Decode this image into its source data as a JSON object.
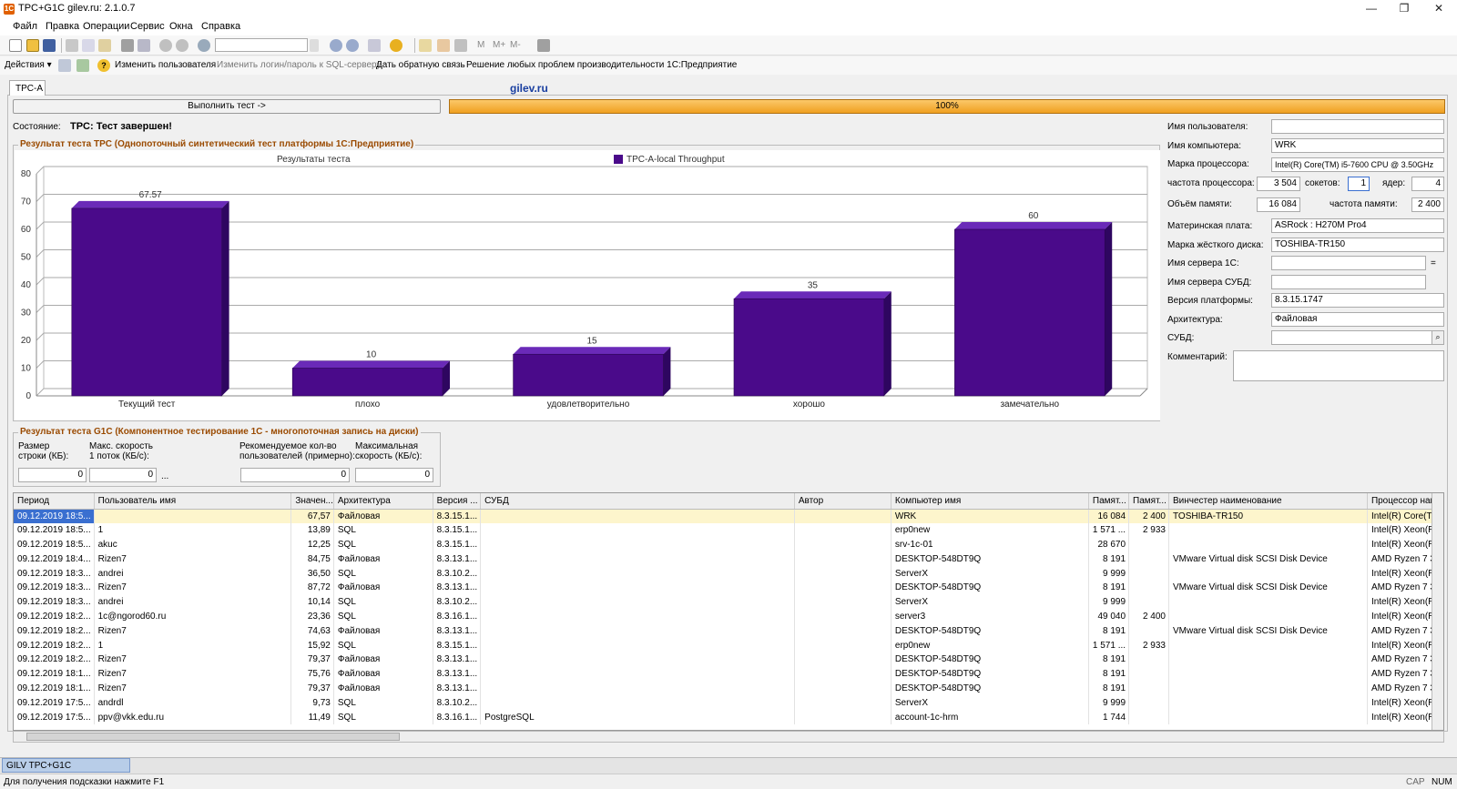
{
  "window": {
    "title": "TPC+G1C gilev.ru: 2.1.0.7",
    "app_icon": "1С"
  },
  "menu": [
    "Файл",
    "Правка",
    "Операции",
    "Сервис",
    "Окна",
    "Справка"
  ],
  "actionbar": {
    "actions_label": "Действия ▾",
    "change_user": "Изменить пользователя",
    "change_login": "Изменить логин/пароль к SQL-серверу",
    "feedback": "Дать обратную связь",
    "solve_problems": "Решение любых проблем производительности 1С:Предприятие"
  },
  "toolbar_text": {
    "m": "M",
    "mplus": "M+",
    "mminus": "M-"
  },
  "tab": {
    "label": "TPC-A"
  },
  "brand": "gilev.ru",
  "run_button": "Выполнить тест ->",
  "progress": {
    "value": 100,
    "label": "100%"
  },
  "state": {
    "label": "Состояние:",
    "value": "TPC: Тест завершен!"
  },
  "tpc_section": "Результат теста TPC (Однопоточный синтетический тест платформы 1С:Предприятие)",
  "chart_data": {
    "type": "bar",
    "title": "Результаты теста",
    "categories": [
      "Текущий тест",
      "плохо",
      "удовлетворительно",
      "хорошо",
      "замечательно"
    ],
    "series": [
      {
        "name": "TPC-A-local Throughput",
        "values": [
          67.57,
          10,
          15,
          35,
          60
        ],
        "labels": [
          "67.57",
          "10",
          "15",
          "35",
          "60"
        ]
      }
    ],
    "ylim": [
      0,
      80
    ],
    "yticks": [
      "0",
      "10",
      "20",
      "30",
      "40",
      "50",
      "60",
      "70",
      "80"
    ],
    "grid": true,
    "legend": "top",
    "bar_color": "#4a0a8a"
  },
  "g1c_section": "Результат теста G1C (Компонентное тестирование 1С - многопоточная запись на диски)",
  "g1c": {
    "row_size_label1": "Размер",
    "row_size_label2": "строки (КБ):",
    "row_size": "0",
    "max_speed_label1": "Макс. скорость",
    "max_speed_label2": "1 поток (КБ/с):",
    "max_speed": "0",
    "ellipsis": "...",
    "users_label1": "Рекомендуемое кол-во",
    "users_label2": "пользователей (примерно):",
    "users": "0",
    "max_total_label1": "Максимальная",
    "max_total_label2": "скорость (КБ/с):",
    "max_total": "0"
  },
  "sysinfo": {
    "user_label": "Имя пользователя:",
    "user": "",
    "computer_label": "Имя компьютера:",
    "computer": "WRK",
    "cpu_label": "Марка процессора:",
    "cpu": "Intel(R) Core(TM) i5-7600 CPU @ 3.50GHz",
    "freq_label": "частота процессора:",
    "freq": "3 504",
    "sockets_label": "сокетов:",
    "sockets": "1",
    "cores_label": "ядер:",
    "cores": "4",
    "mem_label": "Объём памяти:",
    "mem": "16 084",
    "memfreq_label": "частота памяти:",
    "memfreq": "2 400",
    "board_label": "Материнская плата:",
    "board": "ASRock : H270M Pro4",
    "disk_label": "Марка жёсткого диска:",
    "disk": "TOSHIBA-TR150",
    "server1c_label": "Имя сервера 1С:",
    "server1c": "",
    "eq": "=",
    "serverdb_label": "Имя сервера СУБД:",
    "serverdb": "",
    "platform_label": "Версия платформы:",
    "platform": "8.3.15.1747",
    "arch_label": "Архитектура:",
    "arch": "Файловая",
    "dbms_label": "СУБД:",
    "dbms": "",
    "comment_label": "Комментарий:",
    "comment": ""
  },
  "grid": {
    "columns": [
      "Период",
      "Пользователь имя",
      "Значен...",
      "Архитектура",
      "Версия ...",
      "СУБД",
      "Автор",
      "Компьютер имя",
      "Памят...",
      "Памят...",
      "Винчестер наименование",
      "Процессор наи"
    ],
    "rows": [
      [
        "09.12.2019 18:5...",
        "",
        "67,57",
        "Файловая",
        "8.3.15.1...",
        "",
        "",
        "WRK",
        "16 084",
        "2 400",
        "TOSHIBA-TR150",
        "Intel(R) Core(TM"
      ],
      [
        "09.12.2019 18:5...",
        "1",
        "13,89",
        "SQL",
        "8.3.15.1...",
        "",
        "",
        "erp0new",
        "1 571 ...",
        "2 933",
        "",
        "Intel(R) Xeon(R)"
      ],
      [
        "09.12.2019 18:5...",
        "akuc",
        "12,25",
        "SQL",
        "8.3.15.1...",
        "",
        "",
        "srv-1c-01",
        "28 670",
        "",
        "",
        "Intel(R) Xeon(R)"
      ],
      [
        "09.12.2019 18:4...",
        "Rizen7",
        "84,75",
        "Файловая",
        "8.3.13.1...",
        "",
        "",
        "DESKTOP-548DT9Q",
        "8 191",
        "",
        "VMware Virtual disk SCSI Disk Device",
        "AMD Ryzen 7 3"
      ],
      [
        "09.12.2019 18:3...",
        "andrei",
        "36,50",
        "SQL",
        "8.3.10.2...",
        "",
        "",
        "ServerX",
        "9 999",
        "",
        "",
        "Intel(R) Xeon(R)"
      ],
      [
        "09.12.2019 18:3...",
        "Rizen7",
        "87,72",
        "Файловая",
        "8.3.13.1...",
        "",
        "",
        "DESKTOP-548DT9Q",
        "8 191",
        "",
        "VMware Virtual disk SCSI Disk Device",
        "AMD Ryzen 7 3"
      ],
      [
        "09.12.2019 18:3...",
        "andrei",
        "10,14",
        "SQL",
        "8.3.10.2...",
        "",
        "",
        "ServerX",
        "9 999",
        "",
        "",
        "Intel(R) Xeon(R)"
      ],
      [
        "09.12.2019 18:2...",
        "1c@ngorod60.ru",
        "23,36",
        "SQL",
        "8.3.16.1...",
        "",
        "",
        "server3",
        "49 040",
        "2 400",
        "",
        "Intel(R) Xeon(R)"
      ],
      [
        "09.12.2019 18:2...",
        "Rizen7",
        "74,63",
        "Файловая",
        "8.3.13.1...",
        "",
        "",
        "DESKTOP-548DT9Q",
        "8 191",
        "",
        "VMware Virtual disk SCSI Disk Device",
        "AMD Ryzen 7 3"
      ],
      [
        "09.12.2019 18:2...",
        "1",
        "15,92",
        "SQL",
        "8.3.15.1...",
        "",
        "",
        "erp0new",
        "1 571 ...",
        "2 933",
        "",
        "Intel(R) Xeon(R)"
      ],
      [
        "09.12.2019 18:2...",
        "Rizen7",
        "79,37",
        "Файловая",
        "8.3.13.1...",
        "",
        "",
        "DESKTOP-548DT9Q",
        "8 191",
        "",
        "",
        "AMD Ryzen 7 3"
      ],
      [
        "09.12.2019 18:1...",
        "Rizen7",
        "75,76",
        "Файловая",
        "8.3.13.1...",
        "",
        "",
        "DESKTOP-548DT9Q",
        "8 191",
        "",
        "",
        "AMD Ryzen 7 3"
      ],
      [
        "09.12.2019 18:1...",
        "Rizen7",
        "79,37",
        "Файловая",
        "8.3.13.1...",
        "",
        "",
        "DESKTOP-548DT9Q",
        "8 191",
        "",
        "",
        "AMD Ryzen 7 3"
      ],
      [
        "09.12.2019 17:5...",
        "andrdl",
        "9,73",
        "SQL",
        "8.3.10.2...",
        "",
        "",
        "ServerX",
        "9 999",
        "",
        "",
        "Intel(R) Xeon(R)"
      ],
      [
        "09.12.2019 17:5...",
        "ppv@vkk.edu.ru",
        "11,49",
        "SQL",
        "8.3.16.1...",
        "PostgreSQL",
        "",
        "account-1c-hrm",
        "1 744",
        "",
        "",
        "Intel(R) Xeon(R)"
      ]
    ]
  },
  "taskbar": {
    "item": "GILV TPC+G1C"
  },
  "status": {
    "hint": "Для получения подсказки нажмите F1",
    "cap": "CAP",
    "num": "NUM"
  }
}
